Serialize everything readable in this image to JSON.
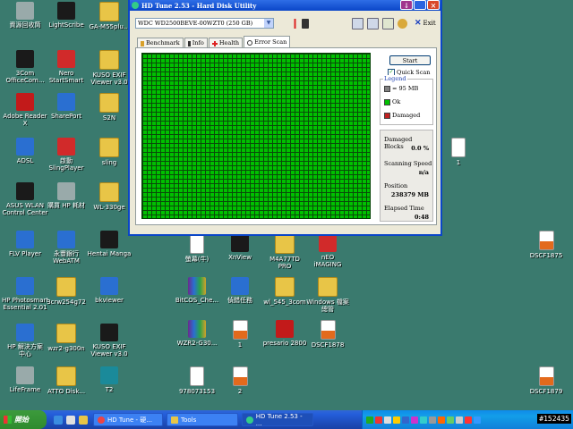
{
  "desktop": {
    "icons": [
      {
        "label": "資源回收筒",
        "kind": "gray"
      },
      {
        "label": "LightScribe",
        "kind": "dark"
      },
      {
        "label": "GA-M55plu...",
        "kind": "folder"
      },
      {
        "label": "3Com\nOfficeCom...",
        "kind": "dark"
      },
      {
        "label": "Nero\nStartSmart",
        "kind": "red"
      },
      {
        "label": "KUSO EXIF\nViewer v3.0",
        "kind": "folder"
      },
      {
        "label": "Adobe Reader\nX",
        "kind": "pdf"
      },
      {
        "label": "SharePort",
        "kind": "blue"
      },
      {
        "label": "S2N",
        "kind": "folder"
      },
      {
        "label": "ADSL",
        "kind": "blue"
      },
      {
        "label": "啟動\nSlingPlayer",
        "kind": "red"
      },
      {
        "label": "sling",
        "kind": "folder"
      },
      {
        "label": "ASUS WLAN\nControl Center",
        "kind": "dark"
      },
      {
        "label": "購買 HP 耗材",
        "kind": "gray"
      },
      {
        "label": "WL-330ge",
        "kind": "folder"
      },
      {
        "label": "FLV Player",
        "kind": "blue"
      },
      {
        "label": "永豐銀行\nWebATM",
        "kind": "blue"
      },
      {
        "label": "Hentai Manga",
        "kind": "dark"
      },
      {
        "label": "HP Photosmart\nEssential 2.01",
        "kind": "blue"
      },
      {
        "label": "3crw254g72",
        "kind": "folder"
      },
      {
        "label": "bkviewer",
        "kind": "blue"
      },
      {
        "label": "HP 解決方案\n中心",
        "kind": "blue"
      },
      {
        "label": "wzr2-g300n",
        "kind": "folder"
      },
      {
        "label": "KUSO EXIF\nViewer v3.0",
        "kind": "dark"
      },
      {
        "label": "LifeFrame",
        "kind": "gray"
      },
      {
        "label": "ATTO Disk...",
        "kind": "folder"
      },
      {
        "label": "T2",
        "kind": "teal"
      },
      {
        "label": "螢幕(牛)",
        "kind": "doc"
      },
      {
        "label": "XnView",
        "kind": "dark"
      },
      {
        "label": "M4A77TD\nPRO",
        "kind": "folder"
      },
      {
        "label": "nEO\niMAGING",
        "kind": "red"
      },
      {
        "label": "BitCOS_Che...",
        "kind": "rar"
      },
      {
        "label": "偵錯任務",
        "kind": "blue"
      },
      {
        "label": "wl_545_3com",
        "kind": "folder"
      },
      {
        "label": "Windows 檔案\n總管",
        "kind": "folder"
      },
      {
        "label": "WZR2-G30...",
        "kind": "rar"
      },
      {
        "label": "1",
        "kind": "pic"
      },
      {
        "label": "presario 2800",
        "kind": "pdf"
      },
      {
        "label": "DSCF1878",
        "kind": "pic"
      },
      {
        "label": "978073153",
        "kind": "doc"
      },
      {
        "label": "2",
        "kind": "pic"
      },
      {
        "label": "1",
        "kind": "doc"
      },
      {
        "label": "DSCF1875",
        "kind": "pic"
      },
      {
        "label": "DSCF1879",
        "kind": "pic"
      }
    ]
  },
  "window": {
    "title": "HD Tune 2.53 - Hard Disk Utility",
    "drive": "WDC WD2500BEVE-00WZT0 (250 GB)",
    "exit_label": "Exit",
    "tabs": [
      "Benchmark",
      "Info",
      "Health",
      "Error Scan"
    ],
    "active_tab": "Error Scan",
    "start_label": "Start",
    "quick_scan_label": "Quick Scan",
    "legend": {
      "caption": "Legend",
      "block_size": "= 95 MB",
      "ok": "Ok",
      "damaged": "Damaged"
    },
    "stats": {
      "damaged_blocks_label": "Damaged Blocks",
      "damaged_blocks_value": "0.0 %",
      "scanning_speed_label": "Scanning Speed",
      "scanning_speed_value": "n/a",
      "position_label": "Position",
      "position_value": "238379 MB",
      "elapsed_label": "Elapsed Time",
      "elapsed_value": "0:48"
    },
    "colors": {
      "ok": "#00c000",
      "damaged": "#c02020",
      "block": "#808080"
    }
  },
  "taskbar": {
    "start_label": "開始",
    "tasks": [
      "HD Tune - 硬...",
      "Tools",
      "HD Tune 2.53 - ..."
    ],
    "active_task": "HD Tune 2.53 - ...",
    "clock": "#152435"
  }
}
